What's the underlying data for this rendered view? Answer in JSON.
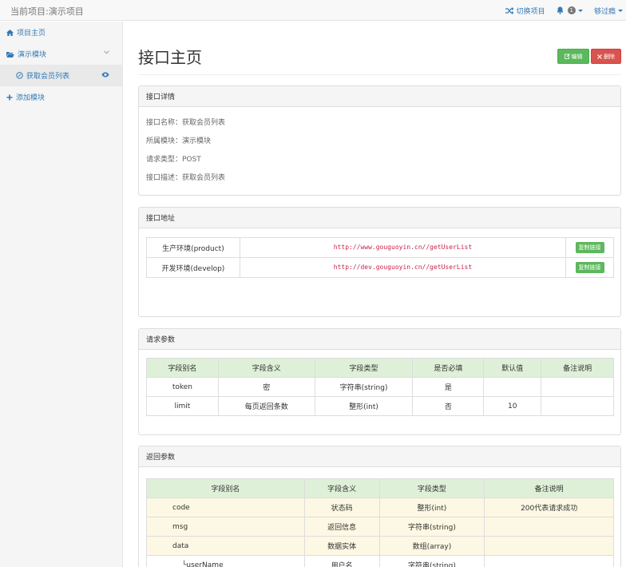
{
  "topbar": {
    "brand": "当前项目:演示项目",
    "switch_project": "切换项目",
    "notification_count": "1",
    "user": "够过瘾"
  },
  "sidebar": {
    "items": [
      {
        "label": "项目主页",
        "icon": "home-icon"
      },
      {
        "label": "演示模块",
        "icon": "folder-open-icon"
      },
      {
        "label": "获取会员列表",
        "icon": "link-icon"
      },
      {
        "label": "添加模块",
        "icon": "plus-icon"
      }
    ]
  },
  "page": {
    "title": "接口主页",
    "edit_label": "编辑",
    "delete_label": "删除"
  },
  "detail": {
    "heading": "接口详情",
    "rows": [
      "接口名称：获取会员列表",
      "所属模块：演示模块",
      "请求类型：POST",
      "接口描述：获取会员列表"
    ]
  },
  "address": {
    "heading": "接口地址",
    "copy_label": "复制链接",
    "rows": [
      {
        "env": "生产环境(product)",
        "url": "http://www.gouguoyin.cn//getUserList"
      },
      {
        "env": "开发环境(develop)",
        "url": "http://dev.gouguoyin.cn//getUserList"
      }
    ]
  },
  "request": {
    "heading": "请求参数",
    "columns": [
      "字段别名",
      "字段含义",
      "字段类型",
      "是否必填",
      "默认值",
      "备注说明"
    ],
    "rows": [
      [
        "token",
        "密",
        "字符串(string)",
        "是",
        "",
        ""
      ],
      [
        "limit",
        "每页返回条数",
        "整形(int)",
        "否",
        "10",
        ""
      ]
    ]
  },
  "response": {
    "heading": "返回参数",
    "columns": [
      "字段别名",
      "字段含义",
      "字段类型",
      "备注说明"
    ],
    "rows": [
      [
        "code",
        "状态码",
        "整形(int)",
        "200代表请求成功"
      ],
      [
        "msg",
        "返回信息",
        "字符串(string)",
        ""
      ],
      [
        "data",
        "数据实体",
        "数组(array)",
        ""
      ],
      [
        "└userName",
        "用户名",
        "字符串(string)",
        ""
      ]
    ]
  },
  "colors": {
    "link": "#337ab7",
    "success": "#5cb85c",
    "danger": "#d9534f",
    "header_green": "#dff0d8",
    "row_yellow": "#fcf8e3"
  }
}
